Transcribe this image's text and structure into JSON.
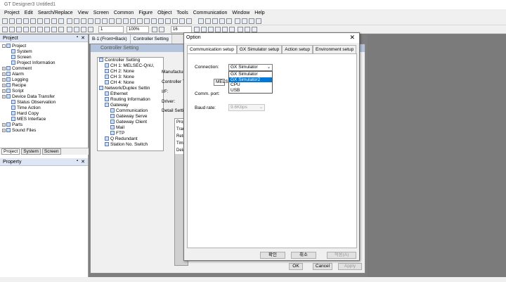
{
  "app": {
    "title": "GT Designer3 Untitled1"
  },
  "menu": [
    "Project",
    "Edit",
    "Search/Replace",
    "View",
    "Screen",
    "Common",
    "Figure",
    "Object",
    "Tools",
    "Communication",
    "Window",
    "Help"
  ],
  "toolbar": {
    "zoom": "100%",
    "font_size": "16",
    "layer": "1"
  },
  "project_pane": {
    "title": "Project",
    "tree": [
      {
        "label": "Project",
        "level": 0,
        "exp": "-"
      },
      {
        "label": "System",
        "level": 1
      },
      {
        "label": "Screen",
        "level": 1
      },
      {
        "label": "Project Information",
        "level": 1
      },
      {
        "label": "Comment",
        "level": 0,
        "exp": "+"
      },
      {
        "label": "Alarm",
        "level": 0,
        "exp": "+"
      },
      {
        "label": "Logging",
        "level": 0,
        "exp": "+"
      },
      {
        "label": "Recipe",
        "level": 0,
        "exp": "+"
      },
      {
        "label": "Script",
        "level": 0,
        "exp": "+"
      },
      {
        "label": "Device Data Transfer",
        "level": 0,
        "exp": "+"
      },
      {
        "label": "Status Observation",
        "level": 1
      },
      {
        "label": "Time Action",
        "level": 1
      },
      {
        "label": "Hard Copy",
        "level": 1
      },
      {
        "label": "MES Interface",
        "level": 1
      },
      {
        "label": "Parts",
        "level": 0,
        "exp": "+"
      },
      {
        "label": "Sound Files",
        "level": 0,
        "exp": "+"
      }
    ],
    "tabs": [
      "Project",
      "System",
      "Screen"
    ]
  },
  "property_pane": {
    "title": "Property"
  },
  "doc_tabs": [
    "B-1:(Front+Back)",
    "Controller Setting"
  ],
  "controller_window": {
    "title": "Controller Setting",
    "tree": [
      {
        "label": "Controller Setting",
        "level": 0
      },
      {
        "label": "CH 1: MELSEC-QnU,",
        "level": 1
      },
      {
        "label": "CH 2: None",
        "level": 1
      },
      {
        "label": "CH 3: None",
        "level": 1
      },
      {
        "label": "CH 4: None",
        "level": 1
      },
      {
        "label": "Network/Duplex Settin",
        "level": 0
      },
      {
        "label": "Ethernet",
        "level": 1
      },
      {
        "label": "Routing Information",
        "level": 1
      },
      {
        "label": "Gateway",
        "level": 1
      },
      {
        "label": "Communication",
        "level": 2
      },
      {
        "label": "Gateway Serve",
        "level": 2
      },
      {
        "label": "Gateway Client",
        "level": 2
      },
      {
        "label": "Mail",
        "level": 2
      },
      {
        "label": "FTP",
        "level": 2
      },
      {
        "label": "Q Redundant",
        "level": 1
      },
      {
        "label": "Station No. Switch",
        "level": 1
      }
    ],
    "labels": {
      "manufacturer": "Manufactur",
      "controller": "Controller T",
      "if": "I/F:",
      "driver": "Driver:",
      "detail": "Detail Settin",
      "melsec": "MELS"
    },
    "prop_rows": [
      "Prop",
      "Tran",
      "Retr",
      "Tim",
      "Dela"
    ],
    "buttons": {
      "ok": "OK",
      "cancel": "Cancel",
      "apply": "Apply"
    }
  },
  "option_dialog": {
    "title": "Option",
    "tabs": [
      "Communication setup",
      "GX Simulator setup",
      "Action setup",
      "Environment setup"
    ],
    "connection_label": "Connection:",
    "connection_value": "GX Simulator",
    "connection_options": [
      "GX Simulator",
      "GX Simulator2",
      "CPU",
      "USB"
    ],
    "comm_port_label": "Comm. port:",
    "baud_label": "Baud rate:",
    "baud_value": "9.6Kbps",
    "buttons": {
      "ok": "확인",
      "cancel": "취소",
      "apply": "적용(A)"
    }
  }
}
